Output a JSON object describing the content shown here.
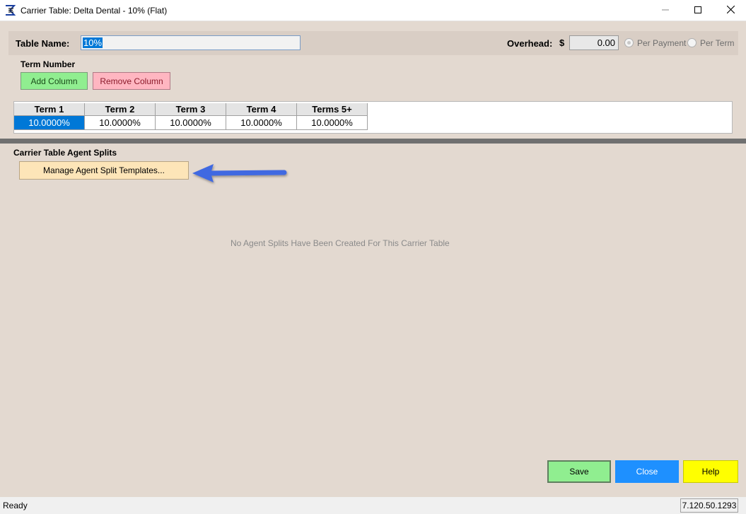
{
  "window": {
    "title": "Carrier Table: Delta Dental - 10% (Flat)"
  },
  "header": {
    "table_name_label": "Table Name:",
    "table_name_value": "10%",
    "overhead_label": "Overhead:",
    "currency_symbol": "$",
    "overhead_value": "0.00",
    "radio_options": [
      {
        "label": "Per Payment",
        "checked": true
      },
      {
        "label": "Per Term",
        "checked": false
      }
    ]
  },
  "terms": {
    "section_label": "Term Number",
    "add_column_label": "Add Column",
    "remove_column_label": "Remove Column",
    "columns": [
      "Term 1",
      "Term 2",
      "Term 3",
      "Term 4",
      "Terms 5+"
    ],
    "values": [
      "10.0000%",
      "10.0000%",
      "10.0000%",
      "10.0000%",
      "10.0000%"
    ],
    "selected_index": 0
  },
  "agent_splits": {
    "section_label": "Carrier Table Agent Splits",
    "manage_button_label": "Manage Agent Split Templates...",
    "empty_message": "No Agent Splits Have Been Created For This Carrier Table"
  },
  "footer": {
    "save_label": "Save",
    "close_label": "Close",
    "help_label": "Help"
  },
  "status": {
    "text": "Ready",
    "version": "7.120.50.1293"
  },
  "colors": {
    "background": "#e3d9d0",
    "add_button": "#90ee90",
    "remove_button": "#ffb6c1",
    "manage_button": "#fde5b8",
    "save_button": "#90ee90",
    "close_button": "#1e90ff",
    "help_button": "#ffff00",
    "selection": "#0078d7",
    "arrow": "#4169e1"
  },
  "icons": {
    "app": "sigma-e-icon",
    "minimize": "minimize-icon",
    "maximize": "maximize-icon",
    "close": "close-icon",
    "annotation_arrow": "arrow-left-icon"
  }
}
